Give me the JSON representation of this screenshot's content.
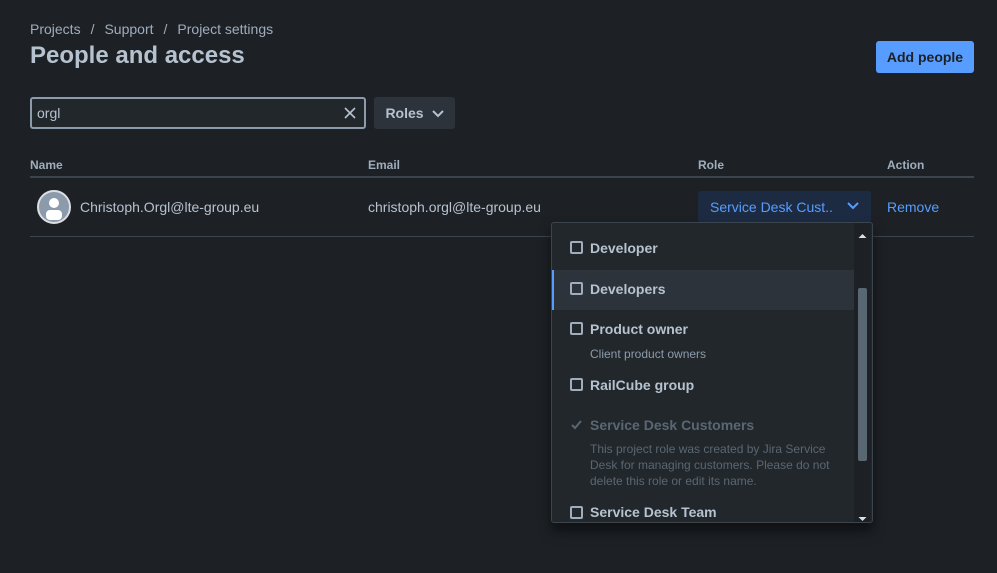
{
  "breadcrumb": [
    "Projects",
    "Support",
    "Project settings"
  ],
  "breadcrumb_sep": "/",
  "page_title": "People and access",
  "add_people_label": "Add people",
  "search": {
    "value": "orgl"
  },
  "roles_filter_label": "Roles",
  "table": {
    "headers": {
      "name": "Name",
      "email": "Email",
      "role": "Role",
      "action": "Action"
    },
    "rows": [
      {
        "name": "Christoph.Orgl@lte-group.eu",
        "email": "christoph.orgl@lte-group.eu",
        "role": "Service Desk Cust...",
        "action": "Remove"
      }
    ]
  },
  "role_options": [
    {
      "label": "Developer",
      "description": "",
      "checked": false,
      "disabled": false,
      "highlighted": false
    },
    {
      "label": "Developers",
      "description": "",
      "checked": false,
      "disabled": false,
      "highlighted": true
    },
    {
      "label": "Product owner",
      "description": "Client product owners",
      "checked": false,
      "disabled": false,
      "highlighted": false
    },
    {
      "label": "RailCube group",
      "description": "",
      "checked": false,
      "disabled": false,
      "highlighted": false
    },
    {
      "label": "Service Desk Customers",
      "description": "This project role was created by Jira Service Desk for managing customers. Please do not delete this role or edit its name.",
      "checked": true,
      "disabled": true,
      "highlighted": false
    },
    {
      "label": "Service Desk Team",
      "description": "",
      "checked": false,
      "disabled": false,
      "highlighted": false
    }
  ],
  "colors": {
    "accent": "#579dff",
    "background": "#1d2125",
    "text": "#b6c2cf"
  },
  "icons": {
    "clear": "close-icon",
    "roles_chevron": "chevron-down-icon",
    "role_chevron": "chevron-down-icon",
    "avatar": "user-avatar-icon"
  }
}
